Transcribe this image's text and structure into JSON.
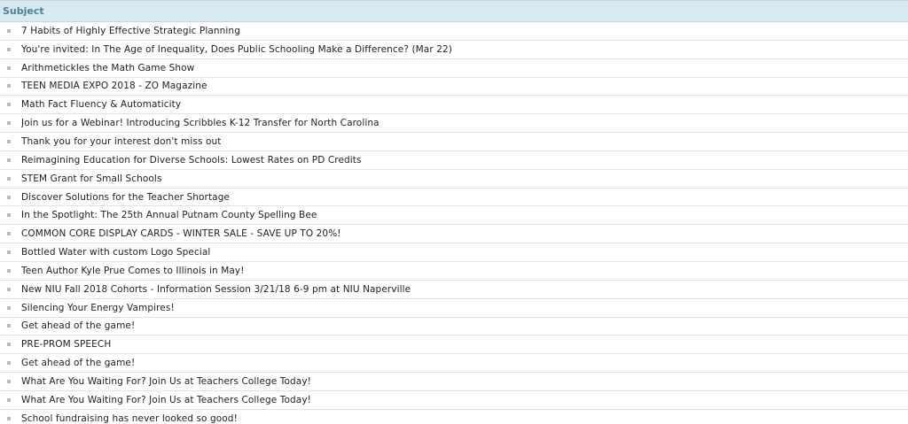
{
  "header": {
    "subject_label": "Subject"
  },
  "rows": [
    "7 Habits of Highly Effective Strategic Planning",
    "You're invited: In The Age of Inequality, Does Public Schooling Make a Difference? (Mar 22)",
    "Arithmetickles the Math Game Show",
    "TEEN MEDIA EXPO 2018 - ZO Magazine",
    "Math Fact Fluency & Automaticity",
    "Join us for a Webinar! Introducing Scribbles K-12 Transfer for North Carolina",
    "Thank you for your interest don't miss out",
    "Reimagining Education for Diverse Schools: Lowest Rates on PD Credits",
    "STEM Grant for Small Schools",
    "Discover Solutions for the Teacher Shortage",
    "In the Spotlight: The 25th Annual Putnam County Spelling Bee",
    "COMMON CORE DISPLAY CARDS - WINTER SALE - SAVE UP TO 20%!",
    "Bottled Water with custom Logo Special",
    "Teen Author Kyle Prue Comes to Illinois in May!",
    "New NIU Fall 2018 Cohorts - Information Session 3/21/18 6-9 pm at NIU Naperville",
    "Silencing Your Energy Vampires!",
    "Get ahead of the game!",
    "PRE-PROM SPEECH",
    "Get ahead of the game!",
    "What Are You Waiting For? Join Us at Teachers College Today!",
    "What Are You Waiting For? Join Us at Teachers College Today!",
    "School fundraising has never looked so good!"
  ]
}
